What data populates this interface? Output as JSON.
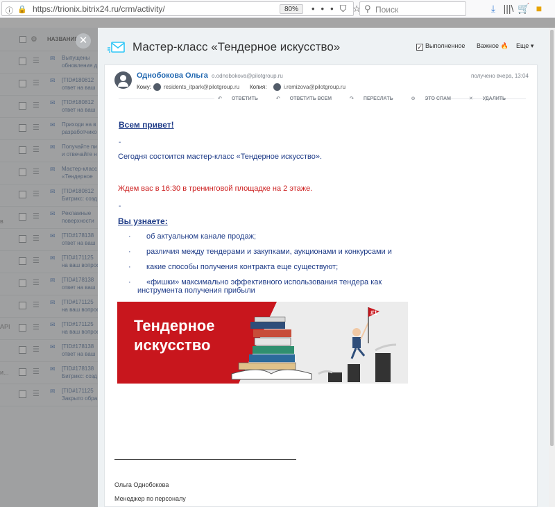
{
  "browser": {
    "url": "https://trionix.bitrix24.ru/crm/activity/",
    "zoom": "80%",
    "search_placeholder": "Поиск"
  },
  "list": {
    "header_name": "НАЗВАНИЕ",
    "rows": [
      {
        "line1": "Выпущены",
        "line2": "обновления д"
      },
      {
        "line1": "[TID#180812",
        "line2": "ответ на ваш"
      },
      {
        "line1": "[TID#180812",
        "line2": "ответ на ваш"
      },
      {
        "line1": "Приходи на в",
        "line2": "разработчико"
      },
      {
        "line1": "Получайте пи",
        "line2": "и отвечайте н"
      },
      {
        "line1": "Мастер-класс",
        "line2": "«Тендерное"
      },
      {
        "line1": "[TID#180812",
        "line2": "Битрикс: созд"
      },
      {
        "line1": "Рекламные",
        "line2": "поверхности"
      },
      {
        "line1": "[TID#178138",
        "line2": "ответ на ваш"
      },
      {
        "line1": "[TID#171125",
        "line2": "на ваш вопрос"
      },
      {
        "line1": "[TID#178138",
        "line2": "ответ на ваш"
      },
      {
        "line1": "[TID#171125",
        "line2": "на ваш вопрос"
      },
      {
        "line1": "[TID#171125",
        "line2": "на ваш вопрос"
      },
      {
        "line1": "[TID#178138",
        "line2": "ответ на ваш"
      },
      {
        "line1": "[TID#178138",
        "line2": "Битрикс: созд"
      },
      {
        "line1": "[TID#171125",
        "line2": "Закрыто обра"
      }
    ],
    "side_fragments": [
      "в",
      "API",
      "и..."
    ]
  },
  "slider": {
    "title": "Мастер-класс «Тендерное искусство»",
    "done_label": "Выполненное",
    "important_label": "Важное",
    "more_label": "Еще"
  },
  "email": {
    "sender_name": "Однобокова Ольга",
    "sender_email": "o.odnobokova@pilotgroup.ru",
    "received": "получено вчера, 13:04",
    "to_label": "Кому:",
    "to_email": "residents_itpark@pilotgroup.ru",
    "cc_label": "Копия:",
    "cc_email": "i.remizova@pilotgroup.ru",
    "actions": {
      "reply": "ОТВЕТИТЬ",
      "reply_all": "ОТВЕТИТЬ ВСЕМ",
      "forward": "ПЕРЕСЛАТЬ",
      "spam": "ЭТО СПАМ",
      "delete": "УДАЛИТЬ"
    },
    "body": {
      "greeting": "Всем привет!",
      "dash": "-",
      "p1": "Сегодня состоится мастер-класс «Тендерное искусство».",
      "p2": "Ждем вас в 16:30 в тренинговой площадке на 2 этаже.",
      "learn": "Вы узнаете:",
      "bullet_char": "·",
      "bullets": [
        "об актуальном канале продаж;",
        "различия между тендерами и закупками, аукционами и конкурсами и",
        "какие способы получения контракта еще существуют;",
        "«фишки» максимально эффективного использования тендера как",
        "инструмента получения прибыли"
      ]
    },
    "banner": {
      "line1": "Тендерное",
      "line2": "искусство",
      "badge": "#1",
      "bg_color": "#c8161d"
    },
    "signature": {
      "name": "Ольга Однобокова",
      "position": "Менеджер по персоналу"
    }
  }
}
